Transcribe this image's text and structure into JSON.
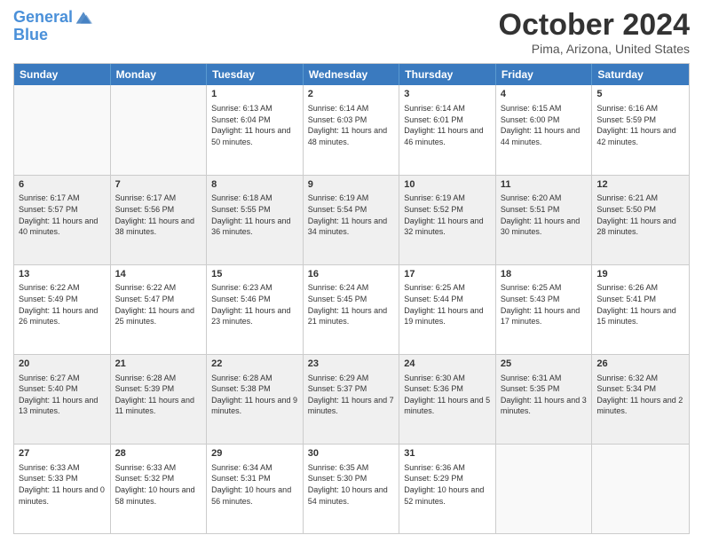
{
  "header": {
    "logo_line1": "General",
    "logo_line2": "Blue",
    "month_title": "October 2024",
    "location": "Pima, Arizona, United States"
  },
  "days_of_week": [
    "Sunday",
    "Monday",
    "Tuesday",
    "Wednesday",
    "Thursday",
    "Friday",
    "Saturday"
  ],
  "weeks": [
    [
      {
        "day": "",
        "empty": true
      },
      {
        "day": "",
        "empty": true
      },
      {
        "day": "1",
        "sunrise": "Sunrise: 6:13 AM",
        "sunset": "Sunset: 6:04 PM",
        "daylight": "Daylight: 11 hours and 50 minutes."
      },
      {
        "day": "2",
        "sunrise": "Sunrise: 6:14 AM",
        "sunset": "Sunset: 6:03 PM",
        "daylight": "Daylight: 11 hours and 48 minutes."
      },
      {
        "day": "3",
        "sunrise": "Sunrise: 6:14 AM",
        "sunset": "Sunset: 6:01 PM",
        "daylight": "Daylight: 11 hours and 46 minutes."
      },
      {
        "day": "4",
        "sunrise": "Sunrise: 6:15 AM",
        "sunset": "Sunset: 6:00 PM",
        "daylight": "Daylight: 11 hours and 44 minutes."
      },
      {
        "day": "5",
        "sunrise": "Sunrise: 6:16 AM",
        "sunset": "Sunset: 5:59 PM",
        "daylight": "Daylight: 11 hours and 42 minutes."
      }
    ],
    [
      {
        "day": "6",
        "sunrise": "Sunrise: 6:17 AM",
        "sunset": "Sunset: 5:57 PM",
        "daylight": "Daylight: 11 hours and 40 minutes."
      },
      {
        "day": "7",
        "sunrise": "Sunrise: 6:17 AM",
        "sunset": "Sunset: 5:56 PM",
        "daylight": "Daylight: 11 hours and 38 minutes."
      },
      {
        "day": "8",
        "sunrise": "Sunrise: 6:18 AM",
        "sunset": "Sunset: 5:55 PM",
        "daylight": "Daylight: 11 hours and 36 minutes."
      },
      {
        "day": "9",
        "sunrise": "Sunrise: 6:19 AM",
        "sunset": "Sunset: 5:54 PM",
        "daylight": "Daylight: 11 hours and 34 minutes."
      },
      {
        "day": "10",
        "sunrise": "Sunrise: 6:19 AM",
        "sunset": "Sunset: 5:52 PM",
        "daylight": "Daylight: 11 hours and 32 minutes."
      },
      {
        "day": "11",
        "sunrise": "Sunrise: 6:20 AM",
        "sunset": "Sunset: 5:51 PM",
        "daylight": "Daylight: 11 hours and 30 minutes."
      },
      {
        "day": "12",
        "sunrise": "Sunrise: 6:21 AM",
        "sunset": "Sunset: 5:50 PM",
        "daylight": "Daylight: 11 hours and 28 minutes."
      }
    ],
    [
      {
        "day": "13",
        "sunrise": "Sunrise: 6:22 AM",
        "sunset": "Sunset: 5:49 PM",
        "daylight": "Daylight: 11 hours and 26 minutes."
      },
      {
        "day": "14",
        "sunrise": "Sunrise: 6:22 AM",
        "sunset": "Sunset: 5:47 PM",
        "daylight": "Daylight: 11 hours and 25 minutes."
      },
      {
        "day": "15",
        "sunrise": "Sunrise: 6:23 AM",
        "sunset": "Sunset: 5:46 PM",
        "daylight": "Daylight: 11 hours and 23 minutes."
      },
      {
        "day": "16",
        "sunrise": "Sunrise: 6:24 AM",
        "sunset": "Sunset: 5:45 PM",
        "daylight": "Daylight: 11 hours and 21 minutes."
      },
      {
        "day": "17",
        "sunrise": "Sunrise: 6:25 AM",
        "sunset": "Sunset: 5:44 PM",
        "daylight": "Daylight: 11 hours and 19 minutes."
      },
      {
        "day": "18",
        "sunrise": "Sunrise: 6:25 AM",
        "sunset": "Sunset: 5:43 PM",
        "daylight": "Daylight: 11 hours and 17 minutes."
      },
      {
        "day": "19",
        "sunrise": "Sunrise: 6:26 AM",
        "sunset": "Sunset: 5:41 PM",
        "daylight": "Daylight: 11 hours and 15 minutes."
      }
    ],
    [
      {
        "day": "20",
        "sunrise": "Sunrise: 6:27 AM",
        "sunset": "Sunset: 5:40 PM",
        "daylight": "Daylight: 11 hours and 13 minutes."
      },
      {
        "day": "21",
        "sunrise": "Sunrise: 6:28 AM",
        "sunset": "Sunset: 5:39 PM",
        "daylight": "Daylight: 11 hours and 11 minutes."
      },
      {
        "day": "22",
        "sunrise": "Sunrise: 6:28 AM",
        "sunset": "Sunset: 5:38 PM",
        "daylight": "Daylight: 11 hours and 9 minutes."
      },
      {
        "day": "23",
        "sunrise": "Sunrise: 6:29 AM",
        "sunset": "Sunset: 5:37 PM",
        "daylight": "Daylight: 11 hours and 7 minutes."
      },
      {
        "day": "24",
        "sunrise": "Sunrise: 6:30 AM",
        "sunset": "Sunset: 5:36 PM",
        "daylight": "Daylight: 11 hours and 5 minutes."
      },
      {
        "day": "25",
        "sunrise": "Sunrise: 6:31 AM",
        "sunset": "Sunset: 5:35 PM",
        "daylight": "Daylight: 11 hours and 3 minutes."
      },
      {
        "day": "26",
        "sunrise": "Sunrise: 6:32 AM",
        "sunset": "Sunset: 5:34 PM",
        "daylight": "Daylight: 11 hours and 2 minutes."
      }
    ],
    [
      {
        "day": "27",
        "sunrise": "Sunrise: 6:33 AM",
        "sunset": "Sunset: 5:33 PM",
        "daylight": "Daylight: 11 hours and 0 minutes."
      },
      {
        "day": "28",
        "sunrise": "Sunrise: 6:33 AM",
        "sunset": "Sunset: 5:32 PM",
        "daylight": "Daylight: 10 hours and 58 minutes."
      },
      {
        "day": "29",
        "sunrise": "Sunrise: 6:34 AM",
        "sunset": "Sunset: 5:31 PM",
        "daylight": "Daylight: 10 hours and 56 minutes."
      },
      {
        "day": "30",
        "sunrise": "Sunrise: 6:35 AM",
        "sunset": "Sunset: 5:30 PM",
        "daylight": "Daylight: 10 hours and 54 minutes."
      },
      {
        "day": "31",
        "sunrise": "Sunrise: 6:36 AM",
        "sunset": "Sunset: 5:29 PM",
        "daylight": "Daylight: 10 hours and 52 minutes."
      },
      {
        "day": "",
        "empty": true
      },
      {
        "day": "",
        "empty": true
      }
    ]
  ]
}
